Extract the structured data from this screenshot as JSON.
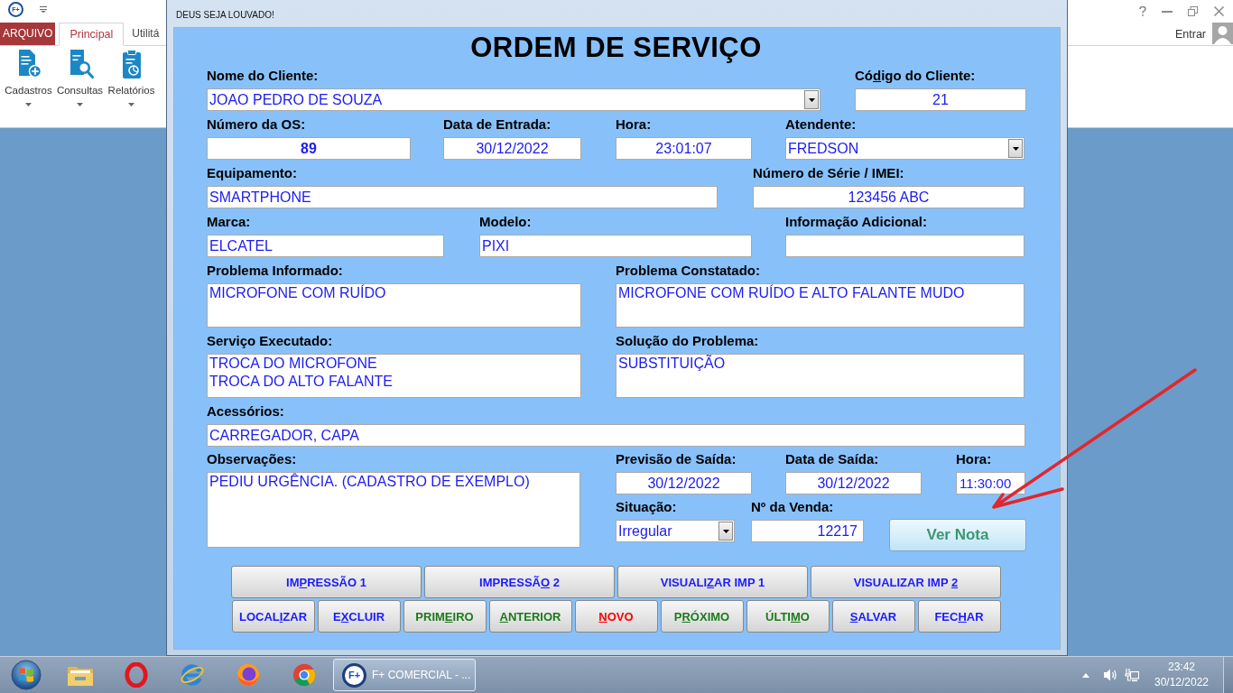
{
  "app": {
    "logo_text": "F+",
    "tabs": [
      {
        "label": "ARQUIVO",
        "kind": "file",
        "selected": false
      },
      {
        "label": "Principal",
        "kind": "tab",
        "selected": true
      },
      {
        "label": "Utilitá",
        "kind": "tab",
        "selected": false
      }
    ],
    "ribbon_buttons": [
      {
        "label": "Cadastros"
      },
      {
        "label": "Consultas"
      },
      {
        "label": "Relatórios"
      }
    ],
    "sign_in": "Entrar"
  },
  "dialog": {
    "title": "DEUS SEJA LOUVADO!",
    "heading": "ORDEM DE SERVIÇO",
    "client_name": {
      "label": "Nome do Cliente:",
      "value": "JOAO PEDRO DE SOUZA"
    },
    "client_code": {
      "label_before": "Có",
      "label_underlined": "d",
      "label_after": "igo do Cliente:",
      "value": "21"
    },
    "os_number": {
      "label": "Número da OS:",
      "value": "89"
    },
    "entry_date": {
      "label": "Data de Entrada:",
      "value": "30/12/2022"
    },
    "entry_time": {
      "label": "Hora:",
      "value": "23:01:07"
    },
    "attendant": {
      "label": "Atendente:",
      "value": "FREDSON"
    },
    "equipment": {
      "label": "Equipamento:",
      "value": "SMARTPHONE"
    },
    "serial": {
      "label": "Número de Série / IMEI:",
      "value": "123456 ABC"
    },
    "brand": {
      "label": "Marca:",
      "value": "ELCATEL"
    },
    "model": {
      "label": "Modelo:",
      "value": "PIXI"
    },
    "additional_info": {
      "label": "Informação Adicional:"
    },
    "reported_problem": {
      "label": "Problema Informado:",
      "value": "MICROFONE COM RUÍDO"
    },
    "found_problem": {
      "label": "Problema Constatado:",
      "value": "MICROFONE COM RUÍDO E ALTO FALANTE MUDO"
    },
    "service_done": {
      "label": "Serviço Executado:",
      "value": "TROCA DO MICROFONE\nTROCA DO ALTO FALANTE"
    },
    "solution": {
      "label": "Solução do Problema:",
      "value": "SUBSTITUIÇÃO"
    },
    "accessories": {
      "label": "Acessórios:",
      "value": "CARREGADOR, CAPA"
    },
    "notes": {
      "label": "Observações:",
      "value": "PEDIU URGÊNCIA. (CADASTRO DE EXEMPLO)"
    },
    "expected_exit": {
      "label": "Previsão de Saída:",
      "value": "30/12/2022"
    },
    "exit_date": {
      "label": "Data de Saída:",
      "value": "30/12/2022"
    },
    "exit_time": {
      "label": "Hora:",
      "value": "11:30:00"
    },
    "status": {
      "label": "Situação:",
      "value": "Irregular"
    },
    "sale_number": {
      "label": "Nº da Venda:",
      "value": "12217"
    },
    "view_invoice": {
      "label": "Ver Nota"
    },
    "print_buttons": [
      {
        "text_before": "IM",
        "underlined": "P",
        "text_after": "RESSÃO 1",
        "color": "#1a1aff"
      },
      {
        "text_before": "IMPRESSÃ",
        "underlined": "O",
        "text_after": " 2",
        "color": "#1a1aff"
      },
      {
        "text_before": "VISUALI",
        "underlined": "Z",
        "text_after": "AR IMP 1",
        "color": "#1a1aff"
      },
      {
        "text_before": "VISUALIZAR IMP ",
        "underlined": "2",
        "color": "#1a1aff"
      }
    ],
    "nav_buttons": [
      {
        "text_before": "LOCAL",
        "underlined": "I",
        "text_after": "ZAR",
        "color": "#1a1aff"
      },
      {
        "text_before": "E",
        "underlined": "X",
        "text_after": "CLUIR",
        "color": "#1a1aff"
      },
      {
        "text_before": "PRIM",
        "underlined": "E",
        "text_after": "IRO",
        "color": "#1b7a1b"
      },
      {
        "underlined": "A",
        "text_after": "NTERIOR",
        "color": "#1b7a1b"
      },
      {
        "underlined": "N",
        "text_after": "OVO",
        "color": "#ff0000"
      },
      {
        "text_before": "P",
        "underlined": "R",
        "text_after": "ÓXIMO",
        "color": "#1b7a1b"
      },
      {
        "text_before": "ÚLTI",
        "underlined": "M",
        "text_after": "O",
        "color": "#1b7a1b"
      },
      {
        "underlined": "S",
        "text_after": "ALVAR",
        "color": "#1a1aff"
      },
      {
        "text_before": "FEC",
        "underlined": "H",
        "text_after": "AR",
        "color": "#1a1aff"
      }
    ]
  },
  "taskbar": {
    "windows": [
      {
        "icon_text": "F+",
        "label": "F+ COMERCIAL - ...",
        "active": true
      }
    ],
    "clock": {
      "time": "23:42",
      "date": "30/12/2022"
    }
  }
}
